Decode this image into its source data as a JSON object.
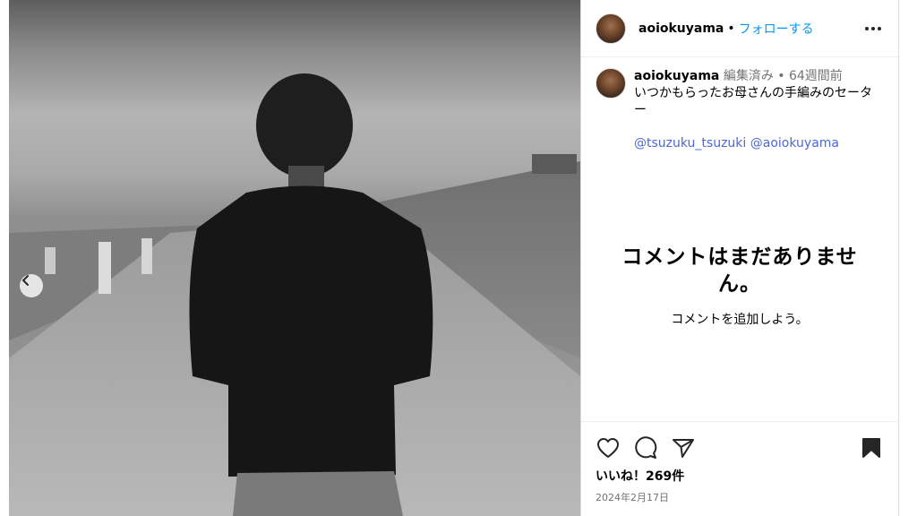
{
  "post": {
    "username": "aoiokuyama",
    "follow_label": "フォローする",
    "separator": "•"
  },
  "caption": {
    "username": "aoiokuyama",
    "meta": "編集済み • 64週間前",
    "text": "いつかもらったお母さんの手編みのセーター",
    "mentions": [
      "@tsuzuku_tsuzuki",
      "@aoiokuyama"
    ]
  },
  "comments": {
    "empty_title": "コメントはまだありません。",
    "empty_sub": "コメントを追加しよう。"
  },
  "engagement": {
    "likes": "いいね！269件",
    "date": "2024年2月17日"
  },
  "icons": {
    "more": "more-horizontal-icon",
    "like": "heart-icon",
    "comment": "comment-bubble-icon",
    "share": "paper-plane-icon",
    "save": "bookmark-icon",
    "carousel_prev": "chevron-left-icon"
  },
  "colors": {
    "link": "#0095f6",
    "mention": "#4c68d7",
    "meta": "#737373"
  }
}
